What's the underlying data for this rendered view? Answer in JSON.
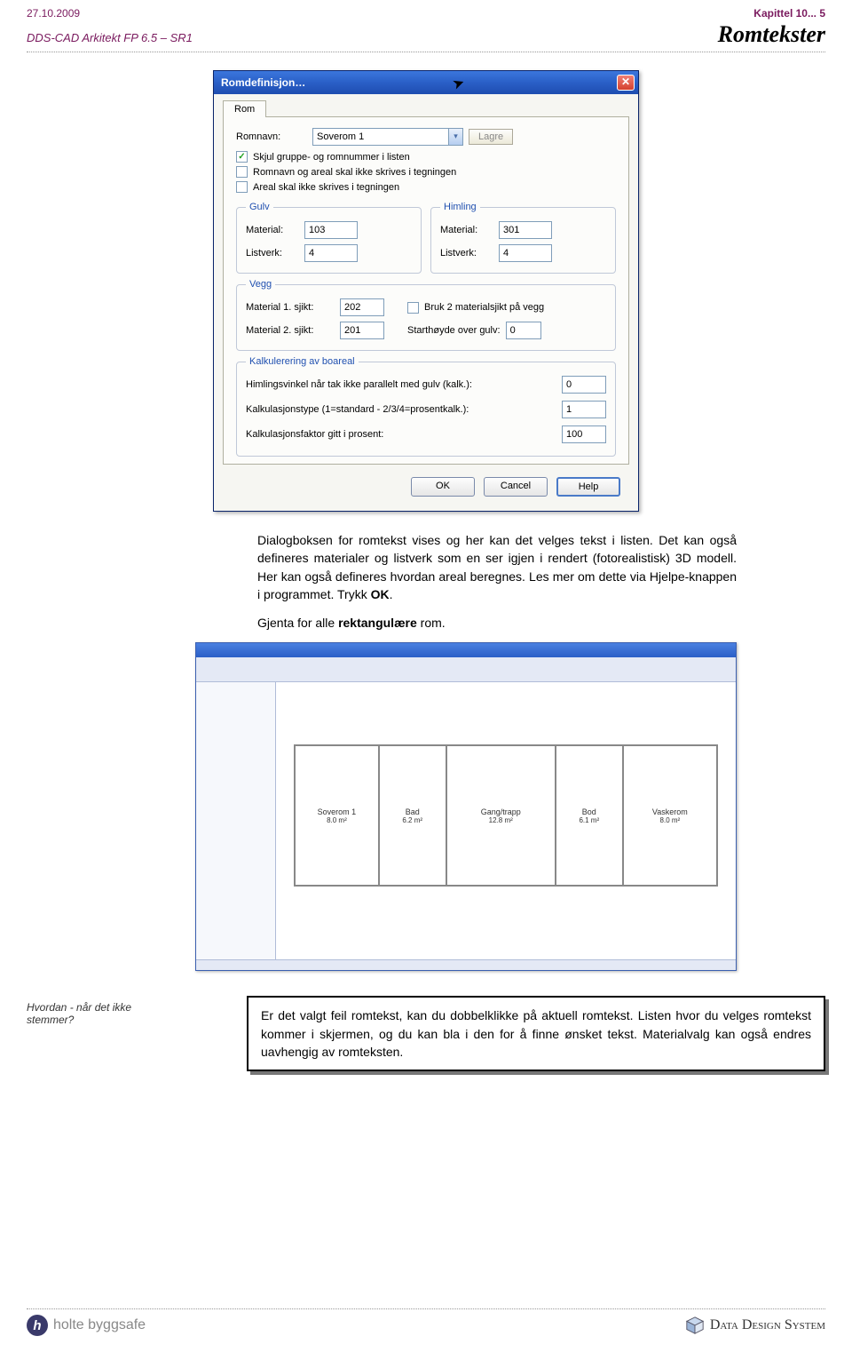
{
  "header": {
    "date": "27.10.2009",
    "chapter": "Kapittel 10... 5",
    "product": "DDS-CAD Arkitekt  FP  6.5 – SR1",
    "title": "Romtekster"
  },
  "dialog": {
    "title": "Romdefinisjon…",
    "tab": "Rom",
    "romnavn_label": "Romnavn:",
    "romnavn_value": "Soverom 1",
    "lagre_btn": "Lagre",
    "cb1_label": "Skjul gruppe- og romnummer i listen",
    "cb1_checked": "✓",
    "cb2_label": "Romnavn og areal skal ikke skrives i tegningen",
    "cb3_label": "Areal skal ikke skrives i tegningen",
    "gulv": {
      "legend": "Gulv",
      "material_label": "Material:",
      "material_value": "103",
      "listverk_label": "Listverk:",
      "listverk_value": "4"
    },
    "himling": {
      "legend": "Himling",
      "material_label": "Material:",
      "material_value": "301",
      "listverk_label": "Listverk:",
      "listverk_value": "4"
    },
    "vegg": {
      "legend": "Vegg",
      "m1_label": "Material 1. sjikt:",
      "m1_value": "202",
      "m2_label": "Material 2. sjikt:",
      "m2_value": "201",
      "bruk2_label": "Bruk 2 materialsjikt på vegg",
      "starth_label": "Starthøyde over gulv:",
      "starth_value": "0"
    },
    "kalk": {
      "legend": "Kalkulerering av boareal",
      "r1_label": "Himlingsvinkel når tak ikke parallelt med gulv (kalk.):",
      "r1_value": "0",
      "r2_label": "Kalkulasjonstype (1=standard - 2/3/4=prosentkalk.):",
      "r2_value": "1",
      "r3_label": "Kalkulasjonsfaktor gitt i prosent:",
      "r3_value": "100"
    },
    "ok_btn": "OK",
    "cancel_btn": "Cancel",
    "help_btn": "Help"
  },
  "para1_a": "Dialogboksen for romtekst vises og her kan det velges tekst i listen. Det kan også defineres materialer og listverk som en ser igjen i rendert (fotorealistisk) 3D modell. Her kan også defineres hvordan areal beregnes. Les mer om dette via Hjelpe-knappen i programmet.  Trykk ",
  "para1_bold": "OK",
  "para1_b": ".",
  "para2_a": "Gjenta for alle ",
  "para2_bold": "rektangulære",
  "para2_b": " rom.",
  "rooms": [
    {
      "name": "Soverom 1",
      "area": "8.0 m²"
    },
    {
      "name": "Bad",
      "area": "6.2 m²"
    },
    {
      "name": "Gang/trapp",
      "area": "12.8 m²"
    },
    {
      "name": "Bod",
      "area": "6.1 m²"
    },
    {
      "name": "Vaskerom",
      "area": "8.0 m²"
    }
  ],
  "note": {
    "side_label": "Hvordan - når det ikke stemmer?",
    "text": "Er det valgt feil romtekst, kan du dobbelklikke på aktuell romtekst. Listen hvor du velges romtekst kommer i skjermen, og du kan bla i den for å finne ønsket tekst. Materialvalg kan også endres uavhengig av romteksten."
  },
  "footer": {
    "holte": "holte byggsafe",
    "dds": "Data Design System"
  }
}
